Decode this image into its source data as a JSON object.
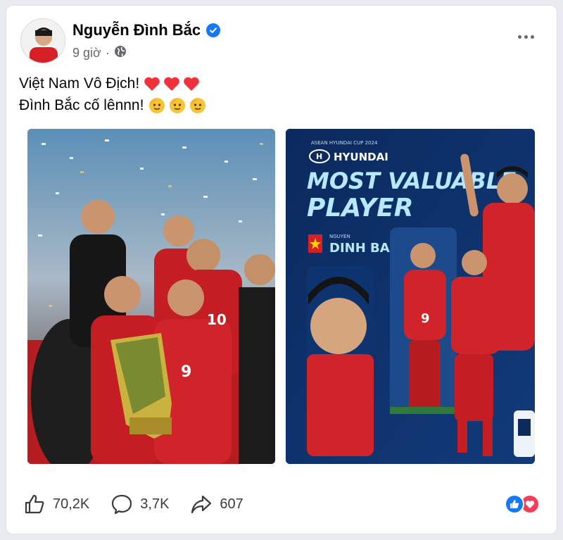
{
  "post": {
    "author": "Nguyễn Đình Bắc",
    "time": "9 giờ",
    "separator": "·",
    "text_line1": "Việt Nam Vô Địch!",
    "text_line2": "Đình Bắc cố lênnn!"
  },
  "images": {
    "mvp": {
      "event": "ASEAN HYUNDAI CUP 2024",
      "brand": "HYUNDAI",
      "title_line1": "MOST VALUABLE",
      "title_line2": "PLAYER",
      "player_first": "NGUYEN",
      "player_last": "DINH BAC",
      "jersey_number": "9"
    },
    "celebration": {
      "jersey_number_1": "10",
      "jersey_number_2": "9"
    }
  },
  "stats": {
    "likes": "70,2K",
    "comments": "3,7K",
    "shares": "607"
  },
  "colors": {
    "accent": "#1877f2",
    "love": "#f33e58",
    "vn_red": "#d71f26",
    "mvp_blue": "#0d2a5b",
    "mvp_text": "#b8e8ff"
  },
  "icons": {
    "verified": "verified-badge-icon",
    "privacy": "globe-icon",
    "more": "more-dots-icon",
    "like": "thumbs-up-icon",
    "comment": "comment-bubble-icon",
    "share": "share-arrow-icon",
    "heart": "red-heart-emoji",
    "face": "salute-face-emoji"
  }
}
